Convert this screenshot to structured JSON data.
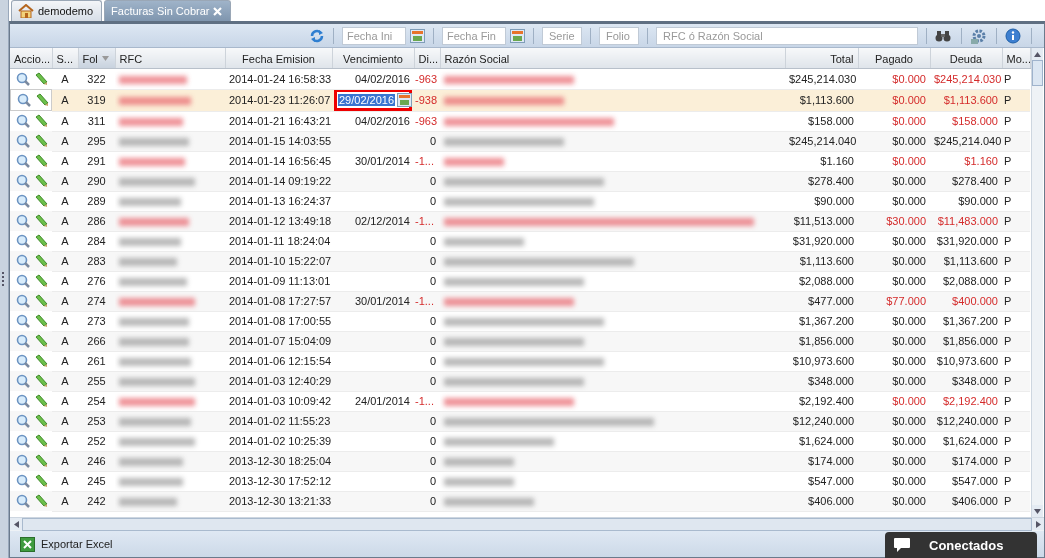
{
  "tabs": [
    {
      "label": "demodemo",
      "kind": "home",
      "selected": false,
      "closable": false
    },
    {
      "label": "Facturas Sin Cobrar",
      "kind": "plain",
      "selected": true,
      "closable": true
    }
  ],
  "toolbar": {
    "fields": [
      {
        "placeholder": "Fecha Ini",
        "kind": "date"
      },
      {
        "placeholder": "Fecha Fin",
        "kind": "date"
      },
      {
        "placeholder": "Serie",
        "kind": "small"
      },
      {
        "placeholder": "Folio",
        "kind": "small"
      },
      {
        "placeholder": "RFC ó Razón Social",
        "kind": "wide"
      }
    ]
  },
  "table": {
    "columns": [
      {
        "label": "Accio...",
        "sorted": false
      },
      {
        "label": "S...",
        "sorted": false
      },
      {
        "label": "Fol",
        "sorted": true
      },
      {
        "label": "RFC",
        "sorted": false
      },
      {
        "label": "Fecha Emision",
        "sorted": false
      },
      {
        "label": "Vencimiento",
        "sorted": false
      },
      {
        "label": "Di...",
        "sorted": false
      },
      {
        "label": "Razón Social",
        "sorted": false
      },
      {
        "label": "Total",
        "sorted": false
      },
      {
        "label": "Pagado",
        "sorted": false
      },
      {
        "label": "Deuda",
        "sorted": false
      },
      {
        "label": "Mo...",
        "sorted": false
      }
    ],
    "rows": [
      {
        "s": "A",
        "fol": "322",
        "emision": "2014-01-24 16:58:33",
        "vencimiento": "04/02/2016",
        "dias": "-963",
        "total": "$245,214.030",
        "pagado": "$0.000",
        "deuda": "$245,214.030",
        "moneda": "P",
        "overdue": true,
        "selected": false,
        "editing": false
      },
      {
        "s": "A",
        "fol": "319",
        "emision": "2014-01-23 11:26:07",
        "vencimiento": "29/02/2016",
        "dias": "-938",
        "total": "$1,113.600",
        "pagado": "$0.000",
        "deuda": "$1,113.600",
        "moneda": "P",
        "overdue": true,
        "selected": true,
        "editing": true
      },
      {
        "s": "A",
        "fol": "311",
        "emision": "2014-01-21 16:43:21",
        "vencimiento": "04/02/2016",
        "dias": "-963",
        "total": "$158.000",
        "pagado": "$0.000",
        "deuda": "$158.000",
        "moneda": "P",
        "overdue": true,
        "selected": false,
        "editing": false
      },
      {
        "s": "A",
        "fol": "295",
        "emision": "2014-01-15 14:03:55",
        "vencimiento": "",
        "dias": "0",
        "total": "$245,214.040",
        "pagado": "$0.000",
        "deuda": "$245,214.040",
        "moneda": "P",
        "overdue": false,
        "selected": false,
        "editing": false
      },
      {
        "s": "A",
        "fol": "291",
        "emision": "2014-01-14 16:56:45",
        "vencimiento": "30/01/2014",
        "dias": "-1...",
        "total": "$1.160",
        "pagado": "$0.000",
        "deuda": "$1.160",
        "moneda": "P",
        "overdue": true,
        "selected": false,
        "editing": false
      },
      {
        "s": "A",
        "fol": "290",
        "emision": "2014-01-14 09:19:22",
        "vencimiento": "",
        "dias": "0",
        "total": "$278.400",
        "pagado": "$0.000",
        "deuda": "$278.400",
        "moneda": "P",
        "overdue": false,
        "selected": false,
        "editing": false
      },
      {
        "s": "A",
        "fol": "289",
        "emision": "2014-01-13 16:24:37",
        "vencimiento": "",
        "dias": "0",
        "total": "$90.000",
        "pagado": "$0.000",
        "deuda": "$90.000",
        "moneda": "P",
        "overdue": false,
        "selected": false,
        "editing": false
      },
      {
        "s": "A",
        "fol": "286",
        "emision": "2014-01-12 13:49:18",
        "vencimiento": "02/12/2014",
        "dias": "-1...",
        "total": "$11,513.000",
        "pagado": "$30.000",
        "deuda": "$11,483.000",
        "moneda": "P",
        "overdue": true,
        "selected": false,
        "editing": false
      },
      {
        "s": "A",
        "fol": "284",
        "emision": "2014-01-11 18:24:04",
        "vencimiento": "",
        "dias": "0",
        "total": "$31,920.000",
        "pagado": "$0.000",
        "deuda": "$31,920.000",
        "moneda": "P",
        "overdue": false,
        "selected": false,
        "editing": false
      },
      {
        "s": "A",
        "fol": "283",
        "emision": "2014-01-10 15:22:07",
        "vencimiento": "",
        "dias": "0",
        "total": "$1,113.600",
        "pagado": "$0.000",
        "deuda": "$1,113.600",
        "moneda": "P",
        "overdue": false,
        "selected": false,
        "editing": false
      },
      {
        "s": "A",
        "fol": "276",
        "emision": "2014-01-09 11:13:01",
        "vencimiento": "",
        "dias": "0",
        "total": "$2,088.000",
        "pagado": "$0.000",
        "deuda": "$2,088.000",
        "moneda": "P",
        "overdue": false,
        "selected": false,
        "editing": false
      },
      {
        "s": "A",
        "fol": "274",
        "emision": "2014-01-08 17:27:57",
        "vencimiento": "30/01/2014",
        "dias": "-1...",
        "total": "$477.000",
        "pagado": "$77.000",
        "deuda": "$400.000",
        "moneda": "P",
        "overdue": true,
        "selected": false,
        "editing": false
      },
      {
        "s": "A",
        "fol": "273",
        "emision": "2014-01-08 17:00:55",
        "vencimiento": "",
        "dias": "0",
        "total": "$1,367.200",
        "pagado": "$0.000",
        "deuda": "$1,367.200",
        "moneda": "P",
        "overdue": false,
        "selected": false,
        "editing": false
      },
      {
        "s": "A",
        "fol": "266",
        "emision": "2014-01-07 15:04:09",
        "vencimiento": "",
        "dias": "0",
        "total": "$1,856.000",
        "pagado": "$0.000",
        "deuda": "$1,856.000",
        "moneda": "P",
        "overdue": false,
        "selected": false,
        "editing": false
      },
      {
        "s": "A",
        "fol": "261",
        "emision": "2014-01-06 12:15:54",
        "vencimiento": "",
        "dias": "0",
        "total": "$10,973.600",
        "pagado": "$0.000",
        "deuda": "$10,973.600",
        "moneda": "P",
        "overdue": false,
        "selected": false,
        "editing": false
      },
      {
        "s": "A",
        "fol": "255",
        "emision": "2014-01-03 12:40:29",
        "vencimiento": "",
        "dias": "0",
        "total": "$348.000",
        "pagado": "$0.000",
        "deuda": "$348.000",
        "moneda": "P",
        "overdue": false,
        "selected": false,
        "editing": false
      },
      {
        "s": "A",
        "fol": "254",
        "emision": "2014-01-03 10:09:42",
        "vencimiento": "24/01/2014",
        "dias": "-1...",
        "total": "$2,192.400",
        "pagado": "$0.000",
        "deuda": "$2,192.400",
        "moneda": "P",
        "overdue": true,
        "selected": false,
        "editing": false
      },
      {
        "s": "A",
        "fol": "253",
        "emision": "2014-01-02 11:55:23",
        "vencimiento": "",
        "dias": "0",
        "total": "$12,240.000",
        "pagado": "$0.000",
        "deuda": "$12,240.000",
        "moneda": "P",
        "overdue": false,
        "selected": false,
        "editing": false
      },
      {
        "s": "A",
        "fol": "252",
        "emision": "2014-01-02 10:25:39",
        "vencimiento": "",
        "dias": "0",
        "total": "$1,624.000",
        "pagado": "$0.000",
        "deuda": "$1,624.000",
        "moneda": "P",
        "overdue": false,
        "selected": false,
        "editing": false
      },
      {
        "s": "A",
        "fol": "246",
        "emision": "2013-12-30 18:25:04",
        "vencimiento": "",
        "dias": "0",
        "total": "$174.000",
        "pagado": "$0.000",
        "deuda": "$174.000",
        "moneda": "P",
        "overdue": false,
        "selected": false,
        "editing": false
      },
      {
        "s": "A",
        "fol": "245",
        "emision": "2013-12-30 17:52:12",
        "vencimiento": "",
        "dias": "0",
        "total": "$547.000",
        "pagado": "$0.000",
        "deuda": "$547.000",
        "moneda": "P",
        "overdue": false,
        "selected": false,
        "editing": false
      },
      {
        "s": "A",
        "fol": "242",
        "emision": "2013-12-30 13:21:33",
        "vencimiento": "",
        "dias": "0",
        "total": "$406.000",
        "pagado": "$0.000",
        "deuda": "$406.000",
        "moneda": "P",
        "overdue": false,
        "selected": false,
        "editing": false
      }
    ]
  },
  "footer": {
    "export_button": "Exportar Excel"
  },
  "status_badge": {
    "label": "Conectados"
  }
}
